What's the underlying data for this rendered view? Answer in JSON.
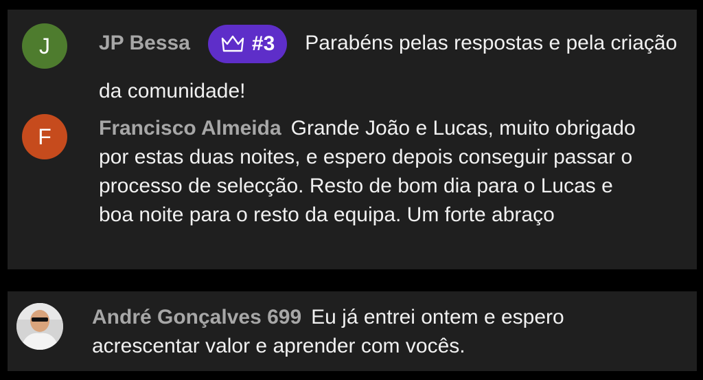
{
  "chat": {
    "messages": [
      {
        "avatar_initial": "J",
        "avatar_color": "#4e7c2e",
        "author": "JP Bessa",
        "badge": {
          "icon": "crown-icon",
          "label": "#3",
          "color": "#5e2ec9"
        },
        "text": "Parabéns pelas respostas e pela criação da comunidade!"
      },
      {
        "avatar_initial": "F",
        "avatar_color": "#c64b1d",
        "author": "Francisco Almeida",
        "text": "Grande João e Lucas, muito obrigado por estas duas noites, e espero depois conseguir passar o processo de selecção. Resto de bom dia para o Lucas e boa noite para o resto da equipa. Um forte abraço"
      },
      {
        "avatar_type": "photo",
        "author": "André Gonçalves 699",
        "text": "Eu já entrei ontem e espero acrescentar valor e aprender com vocês."
      }
    ]
  }
}
